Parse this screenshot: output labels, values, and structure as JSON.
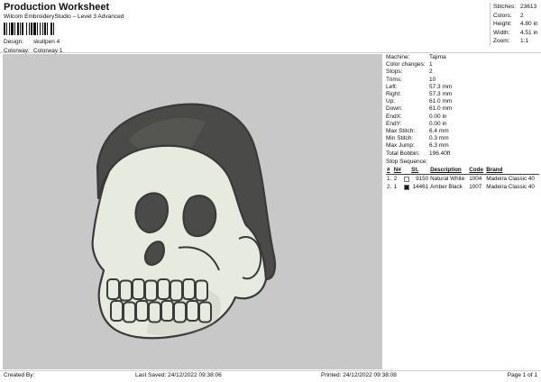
{
  "header": {
    "title": "Production Worksheet",
    "subtitle": "Wilcom EmbroideryStudio – Level 3 Advanced",
    "design_label": "Design:",
    "design_value": "skullpen 4",
    "colorway_label": "Colorway:",
    "colorway_value": "Colorway 1"
  },
  "summary": [
    {
      "label": "Stitches:",
      "value": "23613"
    },
    {
      "label": "Colors:",
      "value": "2"
    },
    {
      "label": "Height:",
      "value": "4.80 in"
    },
    {
      "label": "Width:",
      "value": "4.51 in"
    },
    {
      "label": "Zoom:",
      "value": "1:1"
    }
  ],
  "machine_info": [
    {
      "label": "Machine:",
      "value": "Tajima"
    },
    {
      "label": "Color changes:",
      "value": "1"
    },
    {
      "label": "Stops:",
      "value": "2"
    },
    {
      "label": "Trims:",
      "value": "10"
    },
    {
      "label": "Left:",
      "value": "57.3 mm"
    },
    {
      "label": "Right:",
      "value": "57.3 mm"
    },
    {
      "label": "Up:",
      "value": "61.0 mm"
    },
    {
      "label": "Down:",
      "value": "61.0 mm"
    },
    {
      "label": "EndX:",
      "value": "0.00 in"
    },
    {
      "label": "EndY:",
      "value": "0.00 in"
    },
    {
      "label": "Max Stitch:",
      "value": "6.4 mm"
    },
    {
      "label": "Min Stitch:",
      "value": "0.3 mm"
    },
    {
      "label": "Max Jump:",
      "value": "6.3 mm"
    },
    {
      "label": "Total Bobbin:",
      "value": "196.40ft"
    }
  ],
  "stop_sequence": {
    "heading": "Stop Sequence:",
    "columns": [
      "#",
      "N#",
      "",
      "St.",
      "Description",
      "Code",
      "Brand"
    ],
    "rows": [
      {
        "index": "1.",
        "needle": "2",
        "color": "#f4f1e6",
        "stitches": "9150",
        "description": "Natural White",
        "code": "1004",
        "brand": "Madeira Classic 40"
      },
      {
        "index": "2.",
        "needle": "1",
        "color": "#1a1a1a",
        "stitches": "14461",
        "description": "Amber Black",
        "code": "1007",
        "brand": "Madeira Classic 40"
      }
    ]
  },
  "footer": {
    "created_by": "Created By:",
    "last_saved": "Last Saved: 24/12/2022 09:38:06",
    "printed": "Printed: 24/12/2022 09:38:08",
    "page": "Page 1 of 1"
  },
  "colors": {
    "canvas": "#c8c8c8",
    "skull_fill": "#e6eadf",
    "hair_fill": "#4a4a48",
    "outline": "#3a3a38"
  }
}
